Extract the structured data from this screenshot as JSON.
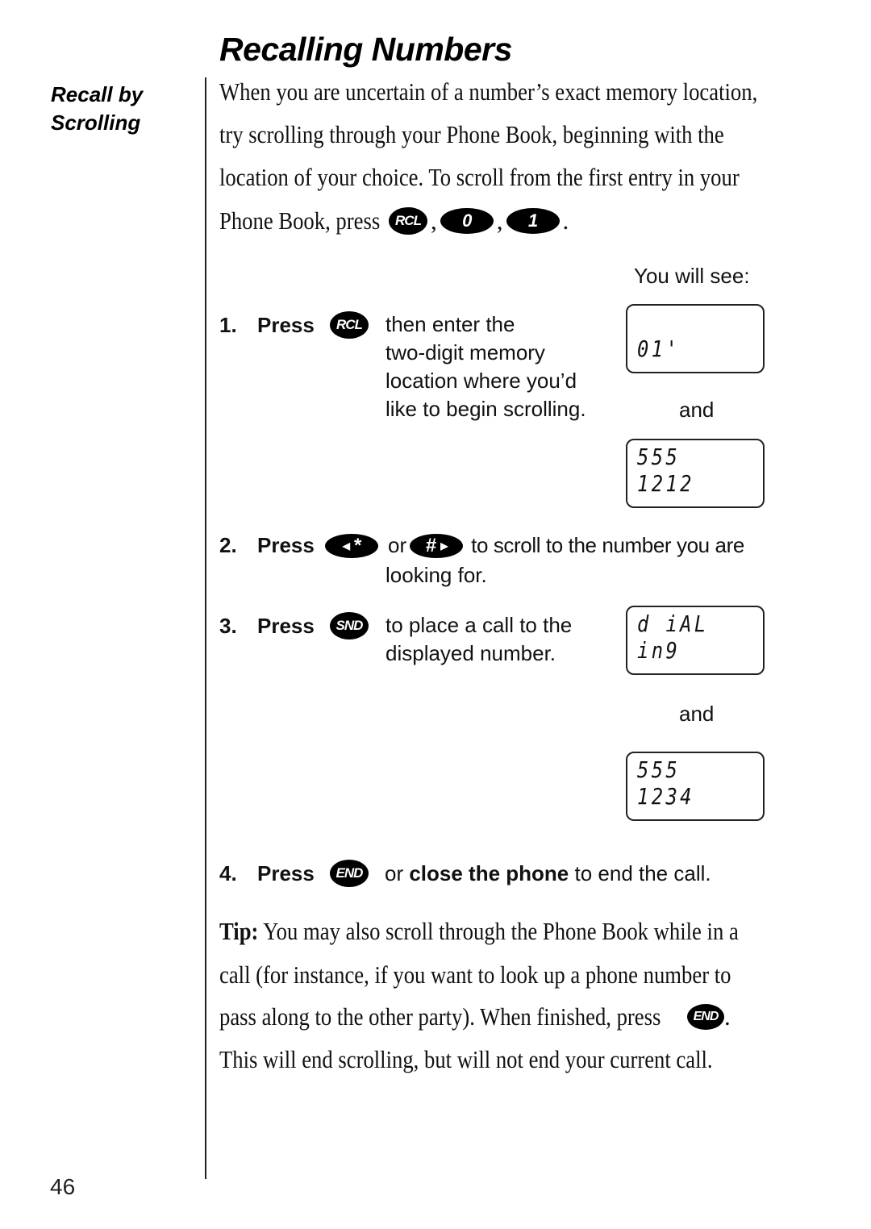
{
  "page": {
    "title": "Recalling Numbers",
    "side_heading_line1": "Recall by",
    "side_heading_line2": "Scrolling",
    "page_number": "46"
  },
  "intro": {
    "lines": [
      "When you are uncertain of a number’s exact memory location,",
      "try scrolling through your Phone Book, beginning with the",
      "location of your choice. To scroll from the first entry in your"
    ],
    "last_line_prefix": "Phone Book, press",
    "keys": [
      "RCL",
      "0",
      "1"
    ],
    "separator": ",",
    "end": "."
  },
  "you_will_see": "You will see:",
  "steps": [
    {
      "number": "1.",
      "press": "Press",
      "key": "RCL",
      "desc_lines": [
        "then enter the",
        "two-digit memory",
        "location where you’d",
        "like to begin scrolling."
      ]
    },
    {
      "number": "2.",
      "press": "Press",
      "key_left": "‹ *",
      "key_left_symbol": "*",
      "key_or": "or",
      "key_right_symbol": "#",
      "desc_line1": "to scroll to the number you are",
      "desc_line2": "looking for."
    },
    {
      "number": "3.",
      "press": "Press",
      "key": "SND",
      "desc_lines": [
        "to place a call to the",
        "displayed number."
      ]
    },
    {
      "number": "4.",
      "press": "Press",
      "key": "END",
      "desc_prefix": "or ",
      "desc_bold": "close the phone",
      "desc_suffix": " to end the call."
    }
  ],
  "displays": [
    {
      "text": "01'"
    },
    {
      "text": "555 1212"
    },
    {
      "text": "d iAL in9"
    },
    {
      "text": "555 1234"
    }
  ],
  "and_label": "and",
  "tip": {
    "label": "Tip:",
    "line1": " You may also scroll through the Phone Book while in a",
    "line2": "call (for instance, if you want to look up a phone number to",
    "line3_prefix": "pass along to the other party). When finished, press",
    "line3_key": "END",
    "line3_end": ".",
    "line4": "This will end scrolling, but will not end your current call."
  }
}
